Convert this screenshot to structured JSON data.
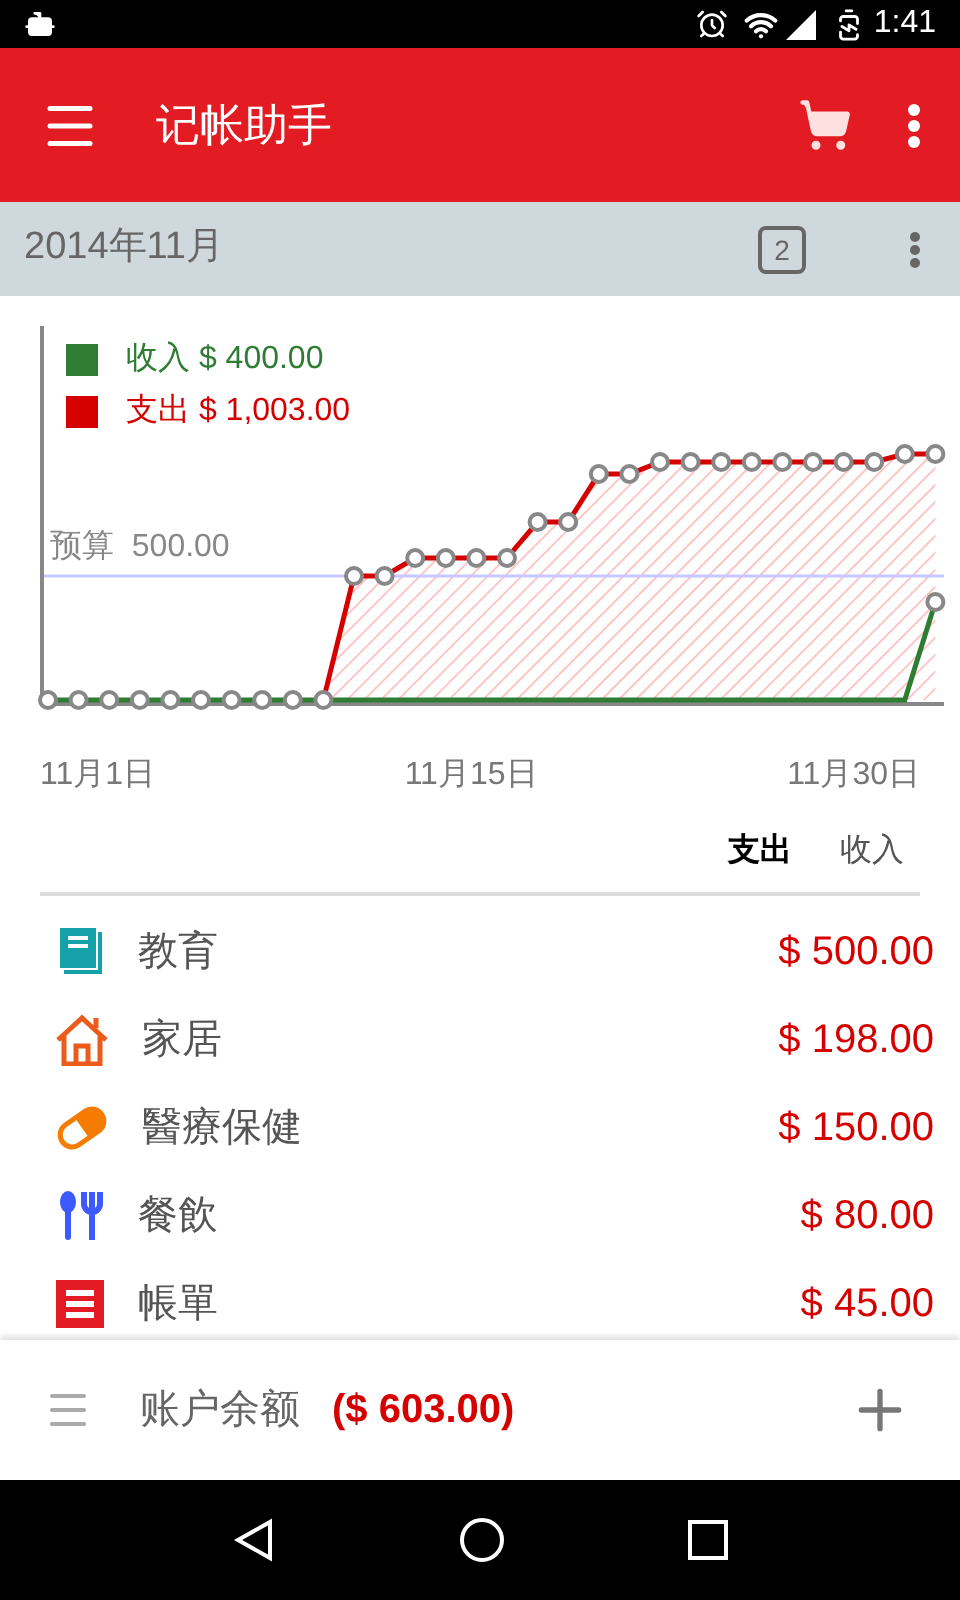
{
  "status_bar": {
    "time": "1:41"
  },
  "app_bar": {
    "title": "记帐助手"
  },
  "period_bar": {
    "title": "2014年11月",
    "day_badge": "2"
  },
  "chart": {
    "legend": [
      {
        "label": "收入 $ 400.00",
        "color": "#2e7d32"
      },
      {
        "label": "支出 $ 1,003.00",
        "color": "#d50000"
      }
    ],
    "budget_label": "预算  500.00",
    "x_labels": [
      "11月1日",
      "11月15日",
      "11月30日"
    ]
  },
  "tabs": [
    {
      "label": "支出",
      "selected": true
    },
    {
      "label": "收入",
      "selected": false
    }
  ],
  "categories": [
    {
      "name": "教育",
      "amount": "$ 500.00",
      "color": "#16a0a8"
    },
    {
      "name": "家居",
      "amount": "$ 198.00",
      "color": "#ec5a1c"
    },
    {
      "name": "醫療保健",
      "amount": "$ 150.00",
      "color": "#f57c00"
    },
    {
      "name": "餐飲",
      "amount": "$ 80.00",
      "color": "#3d5afe"
    },
    {
      "name": "帳單",
      "amount": "$ 45.00",
      "color": "#e31b23"
    }
  ],
  "footer": {
    "label": "账户余额",
    "balance": "($ 603.00)"
  }
}
